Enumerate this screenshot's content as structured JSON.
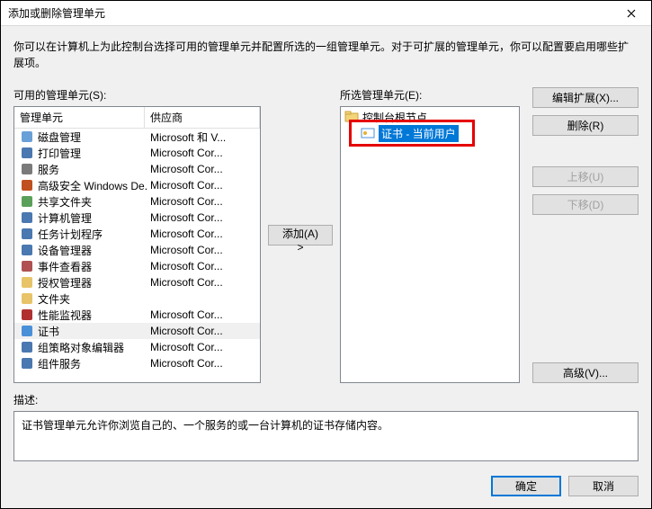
{
  "window": {
    "title": "添加或删除管理单元"
  },
  "intro": "你可以在计算机上为此控制台选择可用的管理单元并配置所选的一组管理单元。对于可扩展的管理单元，你可以配置要启用哪些扩展项。",
  "labels": {
    "available": "可用的管理单元(S):",
    "selected": "所选管理单元(E):",
    "desc_heading": "描述:"
  },
  "columns": {
    "name": "管理单元",
    "vendor": "供应商"
  },
  "snapins": [
    {
      "name": "磁盘管理",
      "vendor": "Microsoft 和 V...",
      "icon": "disk"
    },
    {
      "name": "打印管理",
      "vendor": "Microsoft Cor...",
      "icon": "printer"
    },
    {
      "name": "服务",
      "vendor": "Microsoft Cor...",
      "icon": "gear"
    },
    {
      "name": "高级安全 Windows De...",
      "vendor": "Microsoft Cor...",
      "icon": "firewall"
    },
    {
      "name": "共享文件夹",
      "vendor": "Microsoft Cor...",
      "icon": "share"
    },
    {
      "name": "计算机管理",
      "vendor": "Microsoft Cor...",
      "icon": "computer"
    },
    {
      "name": "任务计划程序",
      "vendor": "Microsoft Cor...",
      "icon": "clock"
    },
    {
      "name": "设备管理器",
      "vendor": "Microsoft Cor...",
      "icon": "device"
    },
    {
      "name": "事件查看器",
      "vendor": "Microsoft Cor...",
      "icon": "event"
    },
    {
      "name": "授权管理器",
      "vendor": "Microsoft Cor...",
      "icon": "folder"
    },
    {
      "name": "文件夹",
      "vendor": "",
      "icon": "folder"
    },
    {
      "name": "性能监视器",
      "vendor": "Microsoft Cor...",
      "icon": "perf"
    },
    {
      "name": "证书",
      "vendor": "Microsoft Cor...",
      "icon": "cert",
      "selected": true
    },
    {
      "name": "组策略对象编辑器",
      "vendor": "Microsoft Cor...",
      "icon": "gpo"
    },
    {
      "name": "组件服务",
      "vendor": "Microsoft Cor...",
      "icon": "comp"
    }
  ],
  "tree": {
    "root": "控制台根节点",
    "child": "证书 - 当前用户"
  },
  "buttons": {
    "add": "添加(A) >",
    "edit_ext": "编辑扩展(X)...",
    "remove": "删除(R)",
    "move_up": "上移(U)",
    "move_down": "下移(D)",
    "advanced": "高级(V)...",
    "ok": "确定",
    "cancel": "取消"
  },
  "description": "证书管理单元允许你浏览自己的、一个服务的或一台计算机的证书存储内容。",
  "icons": {
    "disk": "#6aa0d8",
    "printer": "#4a78b0",
    "gear": "#7a7a7a",
    "firewall": "#c05020",
    "share": "#5aa05a",
    "computer": "#4a78b0",
    "clock": "#4a78b0",
    "device": "#4a78b0",
    "event": "#b05050",
    "folder": "#e8c468",
    "perf": "#b03030",
    "cert": "#4a90d8",
    "gpo": "#4a78b0",
    "comp": "#4a78b0"
  }
}
